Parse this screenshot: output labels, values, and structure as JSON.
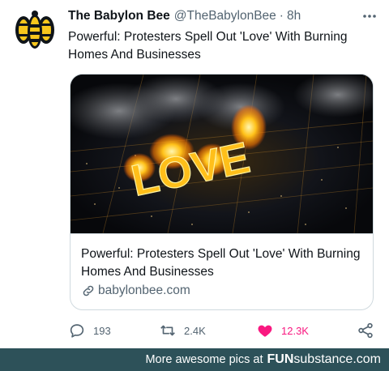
{
  "tweet": {
    "author_name": "The Babylon Bee",
    "handle": "@TheBabylonBee",
    "separator": "·",
    "time": "8h",
    "text": "Powerful: Protesters Spell Out 'Love' With Burning Homes And Businesses"
  },
  "card": {
    "image_text": "LOVE",
    "title": "Powerful: Protesters Spell Out 'Love' With Burning Homes And Businesses",
    "domain": "babylonbee.com"
  },
  "actions": {
    "replies": "193",
    "retweets": "2.4K",
    "likes": "12.3K"
  },
  "footer": {
    "text": "More awesome pics at",
    "brand_a": "FUN",
    "brand_b": "substance",
    "brand_c": ".com"
  },
  "colors": {
    "like_pink": "#f91880",
    "secondary_text": "#536471",
    "footer_bg": "#2d5159",
    "bee_yellow": "#f7c61c"
  },
  "icons": [
    "babylon-bee-logo",
    "more-options-icon",
    "link-icon",
    "reply-icon",
    "retweet-icon",
    "like-icon",
    "share-icon"
  ]
}
